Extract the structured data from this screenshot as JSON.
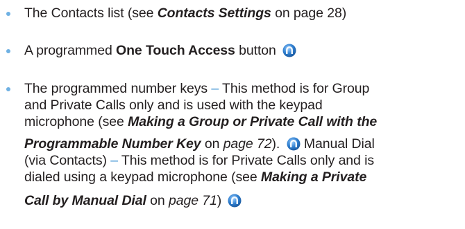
{
  "items": [
    {
      "lines": [
        {
          "pre": "The Contacts list (see ",
          "link": "Contacts Settings",
          "mid": " on page 28)"
        }
      ]
    },
    {
      "pre": "A programmed ",
      "bold": "One Touch Access",
      "post": " button",
      "icon": "one-touch-access-icon"
    },
    {
      "line1_pre": "The programmed number keys ",
      "dash": "–",
      "line1_post": " This method is for Group",
      "line2": "and Private Calls only and is used with the keypad",
      "line3_pre": "microphone (see ",
      "line3_link": "Making a Group or Private Call with the",
      "line4_link": "Programmable Number Key",
      "line4_on": " on ",
      "line4_page": "page 72",
      "line4_close": ").",
      "line4_icon": "manual-dial-icon",
      "line4_post": " Manual Dial",
      "line5_pre": "(via Contacts) ",
      "line5_dash": "–",
      "line5_post": " This method is for Private Calls only and is",
      "line6_pre": "dialed using a keypad microphone (see ",
      "line6_link": "Making a Private",
      "line7_link": "Call by Manual Dial",
      "line7_on": " on ",
      "line7_page": "page 71",
      "line7_close": ")",
      "line7_icon": "one-touch-access-icon"
    }
  ],
  "colors": {
    "text": "#231f20",
    "bullet": "#6fb1e3",
    "dash": "#4a9ad6",
    "icon_fill": "#2f7fd0"
  }
}
